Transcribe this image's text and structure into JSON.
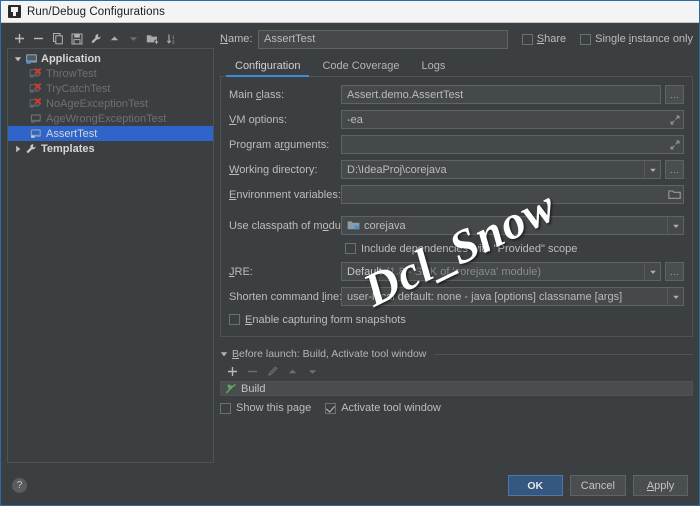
{
  "window": {
    "title": "Run/Debug Configurations",
    "icon": "idea-run-config-icon"
  },
  "tree_toolbar": {
    "buttons": [
      {
        "name": "add-configuration-button",
        "icon": "plus-icon",
        "enabled": true
      },
      {
        "name": "remove-configuration-button",
        "icon": "minus-icon",
        "enabled": true
      },
      {
        "name": "copy-configuration-button",
        "icon": "copy-icon",
        "enabled": true
      },
      {
        "name": "save-configuration-button",
        "icon": "save-icon",
        "enabled": true
      },
      {
        "name": "edit-templates-button",
        "icon": "wrench-icon",
        "enabled": true
      },
      {
        "name": "move-up-button",
        "icon": "arrow-up-icon",
        "enabled": true
      },
      {
        "name": "move-down-button",
        "icon": "arrow-down-icon",
        "enabled": false
      },
      {
        "name": "create-folder-button",
        "icon": "folder-add-icon",
        "enabled": true
      },
      {
        "name": "sort-configurations-button",
        "icon": "sort-icon",
        "enabled": true
      }
    ]
  },
  "tree": {
    "nodes": [
      {
        "label": "Application",
        "level": 0,
        "expanded": true,
        "icon": "application-icon",
        "state": "group",
        "selected": false
      },
      {
        "label": "ThrowTest",
        "level": 1,
        "expanded": null,
        "icon": "class-error-icon",
        "state": "invalid",
        "selected": false
      },
      {
        "label": "TryCatchTest",
        "level": 1,
        "expanded": null,
        "icon": "class-error-icon",
        "state": "invalid",
        "selected": false
      },
      {
        "label": "NoAgeExceptionTest",
        "level": 1,
        "expanded": null,
        "icon": "class-error-icon",
        "state": "invalid",
        "selected": false
      },
      {
        "label": "AgeWrongExceptionTest",
        "level": 1,
        "expanded": null,
        "icon": "class-icon",
        "state": "normal",
        "selected": false
      },
      {
        "label": "AssertTest",
        "level": 1,
        "expanded": null,
        "icon": "class-icon",
        "state": "normal",
        "selected": true
      },
      {
        "label": "Templates",
        "level": 0,
        "expanded": false,
        "icon": "wrench-icon",
        "state": "group",
        "selected": false
      }
    ]
  },
  "name_row": {
    "label": "Name:",
    "label_mnemonic": "N",
    "value": "AssertTest",
    "share": {
      "label": "Share",
      "label_mnemonic": "S",
      "checked": false
    },
    "single_instance": {
      "label": "Single instance only",
      "label_mnemonic": "i",
      "checked": false
    }
  },
  "tabs": [
    {
      "label": "Configuration",
      "active": true
    },
    {
      "label": "Code Coverage",
      "active": false
    },
    {
      "label": "Logs",
      "active": false
    }
  ],
  "configuration": {
    "main_class": {
      "label": "Main class:",
      "label_pre": "Main ",
      "label_mn": "c",
      "label_post": "lass:",
      "value": "Assert.demo.AssertTest",
      "browse_label": "..."
    },
    "vm_options": {
      "label_pre": "",
      "label_mn": "V",
      "label_post": "M options:",
      "value": "-ea",
      "expand_icon": "expand-arrows-icon"
    },
    "program_arguments": {
      "label_pre": "Program a",
      "label_mn": "r",
      "label_post": "guments:",
      "value": "",
      "expand_icon": "expand-arrows-icon"
    },
    "working_directory": {
      "label_pre": "",
      "label_mn": "W",
      "label_post": "orking directory:",
      "value": "D:\\IdeaProj\\corejava",
      "browse_label": "..."
    },
    "environment_variables": {
      "label_pre": "",
      "label_mn": "E",
      "label_post": "nvironment variables:",
      "value": "",
      "browse_icon": "folder-icon"
    },
    "use_classpath_of_module": {
      "label_pre": "Use classpath of m",
      "label_mn": "o",
      "label_post": "dule:",
      "value": "corejava",
      "value_icon": "module-icon"
    },
    "include_provided": {
      "label_pre": "",
      "label_mn": "",
      "label_post": "Include dependencies with \"Provided\" scope",
      "checked": false
    },
    "jre": {
      "label_pre": "",
      "label_mn": "J",
      "label_post": "RE:",
      "value_strong": "Default",
      "value_dim": "(1.8 - SDK of 'corejava' module)",
      "browse_label": "..."
    },
    "shorten_command_line": {
      "label_pre": "Shorten command ",
      "label_mn": "l",
      "label_post": "ine:",
      "value": "user-local default: none - java [options] classname [args]"
    },
    "enable_form_snapshots": {
      "label_pre": "",
      "label_mn": "E",
      "label_post": "nable capturing form snapshots",
      "checked": false
    }
  },
  "before_launch": {
    "header_pre": "",
    "header_mn": "B",
    "header_post": "efore launch: Build, Activate tool window",
    "toolbar": [
      {
        "name": "bl-add-button",
        "icon": "plus-icon",
        "enabled": true
      },
      {
        "name": "bl-remove-button",
        "icon": "minus-icon",
        "enabled": false
      },
      {
        "name": "bl-edit-button",
        "icon": "pencil-icon",
        "enabled": false
      },
      {
        "name": "bl-move-up-button",
        "icon": "arrow-up-icon",
        "enabled": false
      },
      {
        "name": "bl-move-down-button",
        "icon": "arrow-down-icon",
        "enabled": false
      }
    ],
    "tasks": [
      {
        "label": "Build",
        "icon": "build-hammer-icon"
      }
    ],
    "show_this_page": {
      "label": "Show this page",
      "checked": false
    },
    "activate_tool_window": {
      "label": "Activate tool window",
      "checked": true
    }
  },
  "footer": {
    "help_label": "?",
    "ok_label": "OK",
    "cancel_label": "Cancel",
    "apply_pre": "",
    "apply_mn": "A",
    "apply_post": "pply"
  },
  "watermark": {
    "text": "Dcl_Snow"
  },
  "colors": {
    "accent": "#3c8cd9",
    "selection": "#2f65ca",
    "primary_button": "#365880",
    "panel_bg": "#3c3f41",
    "input_bg": "#45494a",
    "error": "#cc3a33",
    "build_icon": "#5ea85e"
  }
}
